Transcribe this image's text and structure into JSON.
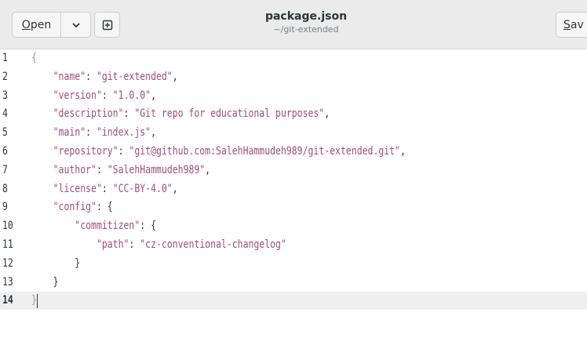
{
  "header": {
    "open_label_u": "O",
    "open_label_rest": "pen",
    "menu_icon": "chevron-down-icon",
    "new_icon": "new-document-icon",
    "save_label_u": "S",
    "save_label_rest": "av",
    "title": "package.json",
    "subtitle": "~/git-extended"
  },
  "editor": {
    "current_line": 14,
    "lines": [
      {
        "num": "1",
        "segments": [
          {
            "t": "{",
            "c": "bm"
          }
        ]
      },
      {
        "num": "2",
        "segments": [
          {
            "t": "    ",
            "c": "p"
          },
          {
            "t": "\"name\"",
            "c": "s"
          },
          {
            "t": ": ",
            "c": "p"
          },
          {
            "t": "\"git-extended\"",
            "c": "s"
          },
          {
            "t": ",",
            "c": "p"
          }
        ]
      },
      {
        "num": "3",
        "segments": [
          {
            "t": "    ",
            "c": "p"
          },
          {
            "t": "\"version\"",
            "c": "s"
          },
          {
            "t": ": ",
            "c": "p"
          },
          {
            "t": "\"1.0.0\"",
            "c": "s"
          },
          {
            "t": ",",
            "c": "p"
          }
        ]
      },
      {
        "num": "4",
        "segments": [
          {
            "t": "    ",
            "c": "p"
          },
          {
            "t": "\"description\"",
            "c": "s"
          },
          {
            "t": ": ",
            "c": "p"
          },
          {
            "t": "\"Git repo for educational purposes\"",
            "c": "s"
          },
          {
            "t": ",",
            "c": "p"
          }
        ]
      },
      {
        "num": "5",
        "segments": [
          {
            "t": "    ",
            "c": "p"
          },
          {
            "t": "\"main\"",
            "c": "s"
          },
          {
            "t": ": ",
            "c": "p"
          },
          {
            "t": "\"index.js\"",
            "c": "s"
          },
          {
            "t": ",",
            "c": "p"
          }
        ]
      },
      {
        "num": "6",
        "segments": [
          {
            "t": "    ",
            "c": "p"
          },
          {
            "t": "\"repository\"",
            "c": "s"
          },
          {
            "t": ": ",
            "c": "p"
          },
          {
            "t": "\"git@github.com:SalehHammudeh989/git-extended.git\"",
            "c": "s"
          },
          {
            "t": ",",
            "c": "p"
          }
        ]
      },
      {
        "num": "7",
        "segments": [
          {
            "t": "    ",
            "c": "p"
          },
          {
            "t": "\"author\"",
            "c": "s"
          },
          {
            "t": ": ",
            "c": "p"
          },
          {
            "t": "\"SalehHammudeh989\"",
            "c": "s"
          },
          {
            "t": ",",
            "c": "p"
          }
        ]
      },
      {
        "num": "8",
        "segments": [
          {
            "t": "    ",
            "c": "p"
          },
          {
            "t": "\"license\"",
            "c": "s"
          },
          {
            "t": ": ",
            "c": "p"
          },
          {
            "t": "\"CC-BY-4.0\"",
            "c": "s"
          },
          {
            "t": ",",
            "c": "p"
          }
        ]
      },
      {
        "num": "9",
        "segments": [
          {
            "t": "    ",
            "c": "p"
          },
          {
            "t": "\"config\"",
            "c": "s"
          },
          {
            "t": ": {",
            "c": "p"
          }
        ]
      },
      {
        "num": "10",
        "segments": [
          {
            "t": "        ",
            "c": "p"
          },
          {
            "t": "\"commitizen\"",
            "c": "s"
          },
          {
            "t": ": {",
            "c": "p"
          }
        ]
      },
      {
        "num": "11",
        "segments": [
          {
            "t": "            ",
            "c": "p"
          },
          {
            "t": "\"path\"",
            "c": "s"
          },
          {
            "t": ": ",
            "c": "p"
          },
          {
            "t": "\"cz-conventional-changelog\"",
            "c": "s"
          }
        ]
      },
      {
        "num": "12",
        "segments": [
          {
            "t": "        }",
            "c": "p"
          }
        ]
      },
      {
        "num": "13",
        "segments": [
          {
            "t": "    }",
            "c": "p"
          }
        ]
      },
      {
        "num": "14",
        "segments": [
          {
            "t": "}",
            "c": "bm"
          }
        ]
      }
    ]
  }
}
